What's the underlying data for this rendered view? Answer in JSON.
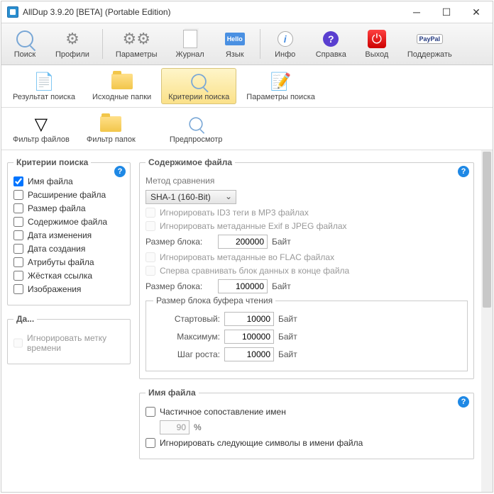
{
  "title": "AllDup 3.9.20 [BETA] (Portable Edition)",
  "toolbar1": [
    {
      "label": "Поиск"
    },
    {
      "label": "Профили"
    },
    {
      "label": "Параметры"
    },
    {
      "label": "Журнал"
    },
    {
      "label": "Язык"
    },
    {
      "label": "Инфо"
    },
    {
      "label": "Справка"
    },
    {
      "label": "Выход"
    },
    {
      "label": "Поддержать"
    }
  ],
  "toolbar2": [
    {
      "label": "Результат поиска"
    },
    {
      "label": "Исходные папки"
    },
    {
      "label": "Критерии поиска"
    },
    {
      "label": "Параметры поиска"
    }
  ],
  "toolbar3": [
    {
      "label": "Фильтр файлов"
    },
    {
      "label": "Фильтр папок"
    },
    {
      "label": "Предпросмотр"
    }
  ],
  "criteria": {
    "legend": "Критерии поиска",
    "items": [
      {
        "label": "Имя файла",
        "checked": true
      },
      {
        "label": "Расширение файла"
      },
      {
        "label": "Размер файла"
      },
      {
        "label": "Содержимое файла"
      },
      {
        "label": "Дата изменения"
      },
      {
        "label": "Дата создания"
      },
      {
        "label": "Атрибуты файла"
      },
      {
        "label": "Жёсткая ссылка"
      },
      {
        "label": "Изображения"
      }
    ]
  },
  "date_group": {
    "legend": "Да...",
    "ignore_ts": "Игнорировать метку времени"
  },
  "content": {
    "legend": "Содержимое файла",
    "method_label": "Метод сравнения",
    "method_value": "SHA-1 (160-Bit)",
    "ignore_id3": "Игнорировать ID3 теги в MP3 файлах",
    "ignore_exif": "Игнорировать метаданные Exif в JPEG файлах",
    "block_label": "Размер блока:",
    "block1": "200000",
    "unit": "Байт",
    "ignore_flac": "Игнорировать метаданные во FLAC файлах",
    "compare_end": "Сперва сравнивать блок данных в конце файла",
    "block2": "100000",
    "buffer": {
      "legend": "Размер блока буфера чтения",
      "start_label": "Стартовый:",
      "start": "10000",
      "max_label": "Максимум:",
      "max": "100000",
      "step_label": "Шаг роста:",
      "step": "10000"
    }
  },
  "filename": {
    "legend": "Имя файла",
    "partial": "Частичное сопоставление имен",
    "percent": "90",
    "pct_unit": "%",
    "ignore_chars": "Игнорировать следующие символы в имени файла"
  }
}
